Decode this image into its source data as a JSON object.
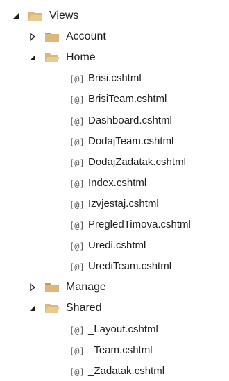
{
  "tree": [
    {
      "label": "Views",
      "type": "folder",
      "state": "expanded",
      "depth": 0
    },
    {
      "label": "Account",
      "type": "folder",
      "state": "collapsed",
      "depth": 1
    },
    {
      "label": "Home",
      "type": "folder",
      "state": "expanded",
      "depth": 1
    },
    {
      "label": "Brisi.cshtml",
      "type": "file",
      "icon": "[@]",
      "depth": 2
    },
    {
      "label": "BrisiTeam.cshtml",
      "type": "file",
      "icon": "[@]",
      "depth": 2
    },
    {
      "label": "Dashboard.cshtml",
      "type": "file",
      "icon": "[@]",
      "depth": 2
    },
    {
      "label": "DodajTeam.cshtml",
      "type": "file",
      "icon": "[@]",
      "depth": 2
    },
    {
      "label": "DodajZadatak.cshtml",
      "type": "file",
      "icon": "[@]",
      "depth": 2
    },
    {
      "label": "Index.cshtml",
      "type": "file",
      "icon": "[@]",
      "depth": 2
    },
    {
      "label": "Izvjestaj.cshtml",
      "type": "file",
      "icon": "[@]",
      "depth": 2
    },
    {
      "label": "PregledTimova.cshtml",
      "type": "file",
      "icon": "[@]",
      "depth": 2
    },
    {
      "label": "Uredi.cshtml",
      "type": "file",
      "icon": "[@]",
      "depth": 2
    },
    {
      "label": "UrediTeam.cshtml",
      "type": "file",
      "icon": "[@]",
      "depth": 2
    },
    {
      "label": "Manage",
      "type": "folder",
      "state": "collapsed",
      "depth": 1
    },
    {
      "label": "Shared",
      "type": "folder",
      "state": "expanded",
      "depth": 1
    },
    {
      "label": "_Layout.cshtml",
      "type": "file",
      "icon": "[@]",
      "depth": 2
    },
    {
      "label": "_Team.cshtml",
      "type": "file",
      "icon": "[@]",
      "depth": 2
    },
    {
      "label": "_Zadatak.cshtml",
      "type": "file",
      "icon": "[@]",
      "depth": 2
    }
  ],
  "colors": {
    "folder": "#dcb67a",
    "folder_dark": "#c39a55",
    "open_folder_front": "#e8cc8f",
    "arrow": "#1e1e1e",
    "file_icon": "#5a5a5a",
    "text": "#1e1e1e"
  }
}
